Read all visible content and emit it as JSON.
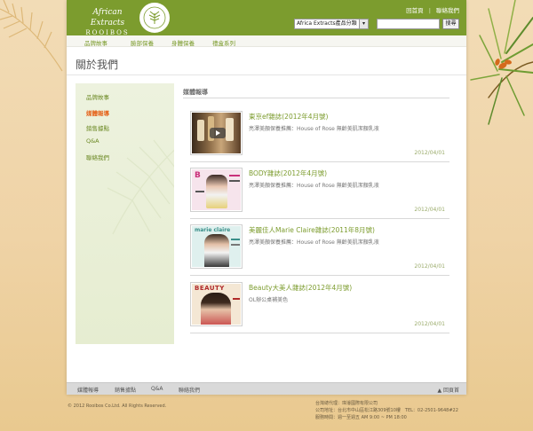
{
  "header": {
    "logo_script": "African Extracts",
    "logo_word": "ROOIBOS",
    "top_links": [
      "回首頁",
      "聯絡我們"
    ],
    "product_select": "Africa Extracts產品分類",
    "search_button": "搜尋",
    "search_placeholder": ""
  },
  "nav": [
    "品牌故事",
    "臉部保養",
    "身體保養",
    "禮盒系列"
  ],
  "page_title": "關於我們",
  "sidebar": {
    "items": [
      {
        "label": "品牌故事",
        "active": false
      },
      {
        "label": "媒體報導",
        "active": true
      },
      {
        "label": "銷售據點",
        "active": false
      },
      {
        "label": "Q&A",
        "active": false
      },
      {
        "label": "聯絡我們",
        "active": false
      }
    ]
  },
  "section_title": "媒體報導",
  "articles": [
    {
      "title": "東京ef雜誌(2012年4月號)",
      "desc": "亮澤美顏保養推薦：House of Rose 無齡美肌潔顏乳液",
      "date": "2012/04/01",
      "thumb": "video"
    },
    {
      "title": "BODY雜誌(2012年4月號)",
      "desc": "亮澤美顏保養推薦：House of Rose 無齡美肌潔顏乳液",
      "date": "2012/04/01",
      "thumb": "magazine"
    },
    {
      "title": "美麗佳人Marie Claire雜誌(2011年8月號)",
      "desc": "亮澤美顏保養推薦：House of Rose 無齡美肌潔顏乳液",
      "date": "2012/04/01",
      "thumb": "magazine"
    },
    {
      "title": "Beauty大美人雜誌(2012年4月號)",
      "desc": "OL辦公桌補美色",
      "date": "2012/04/01",
      "thumb": "magazine"
    }
  ],
  "footer": {
    "links": [
      "媒體報導",
      "銷售據點",
      "Q&A",
      "聯絡我們"
    ],
    "back_to_top": "▲ 回頁首",
    "copyright": "© 2012 Rooibos Co.Ltd. All Rights Reserved.",
    "company_lines": [
      "台灣總代理：瑋濬國際有限公司",
      "公司地址：台北市中山區松江路309號10樓　TEL：02-2501-9648#22",
      "服務時間：週一至週五 AM 9:00 ~ PM 18:00"
    ]
  },
  "colors": {
    "brand_green": "#7c9c2e",
    "active_orange": "#e5641c",
    "sand": "#efd3a6"
  }
}
